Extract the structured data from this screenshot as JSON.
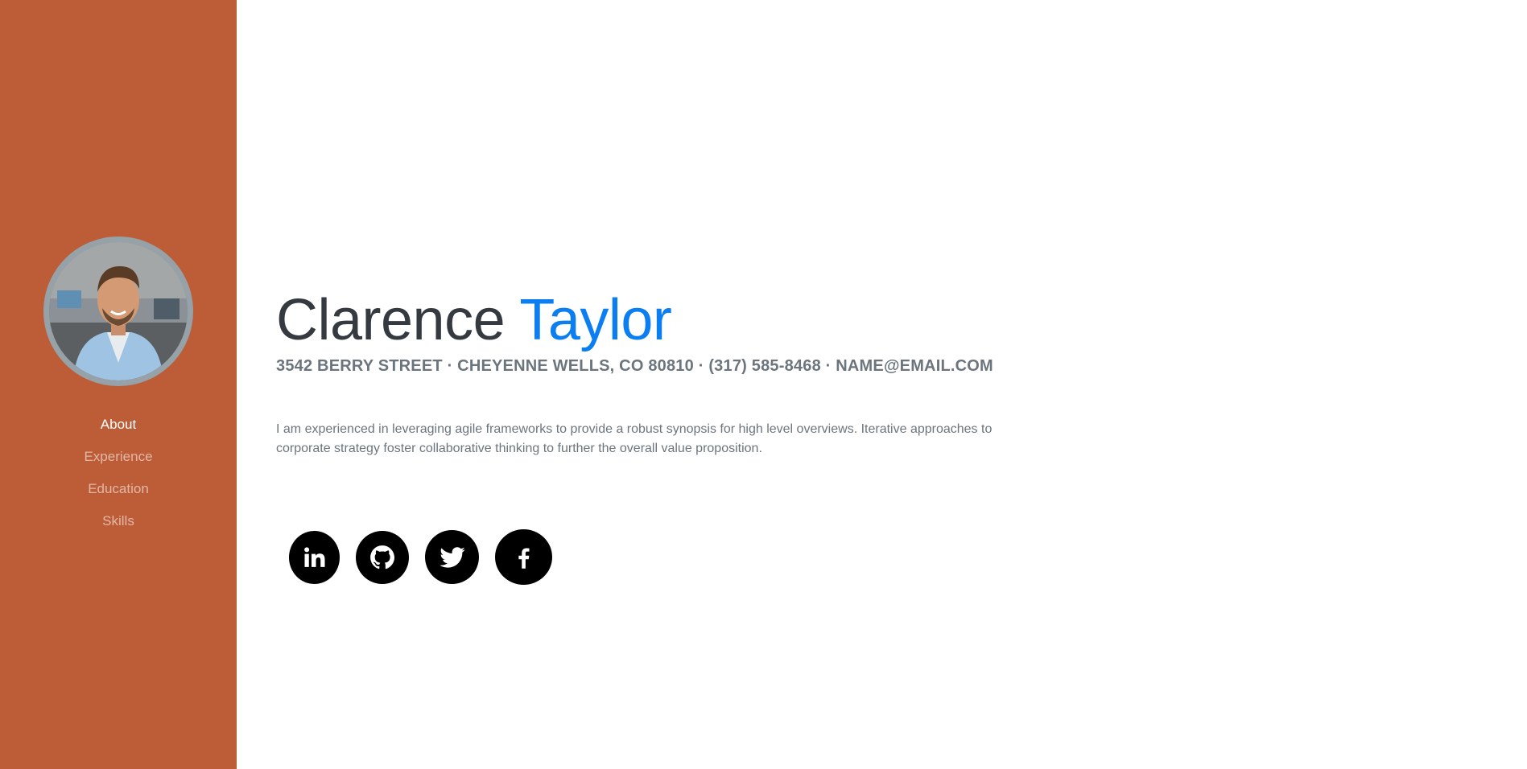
{
  "sidebar": {
    "bg_color": "#bd5d38",
    "nav": [
      {
        "label": "About",
        "active": true
      },
      {
        "label": "Experience",
        "active": false
      },
      {
        "label": "Education",
        "active": false
      },
      {
        "label": "Skills",
        "active": false
      }
    ]
  },
  "profile": {
    "first_name": "Clarence",
    "last_name": "Taylor",
    "accent_color": "#0b7ef2",
    "contact_line": "3542 Berry Street · Cheyenne Wells, CO 80810 · (317) 585-8468 · name@email.com",
    "bio": "I am experienced in leveraging agile frameworks to provide a robust synopsis for high level overviews. Iterative approaches to corporate strategy foster collaborative thinking to further the overall value proposition."
  },
  "social": [
    {
      "icon": "linkedin-icon"
    },
    {
      "icon": "github-icon"
    },
    {
      "icon": "twitter-icon"
    },
    {
      "icon": "facebook-icon"
    }
  ]
}
